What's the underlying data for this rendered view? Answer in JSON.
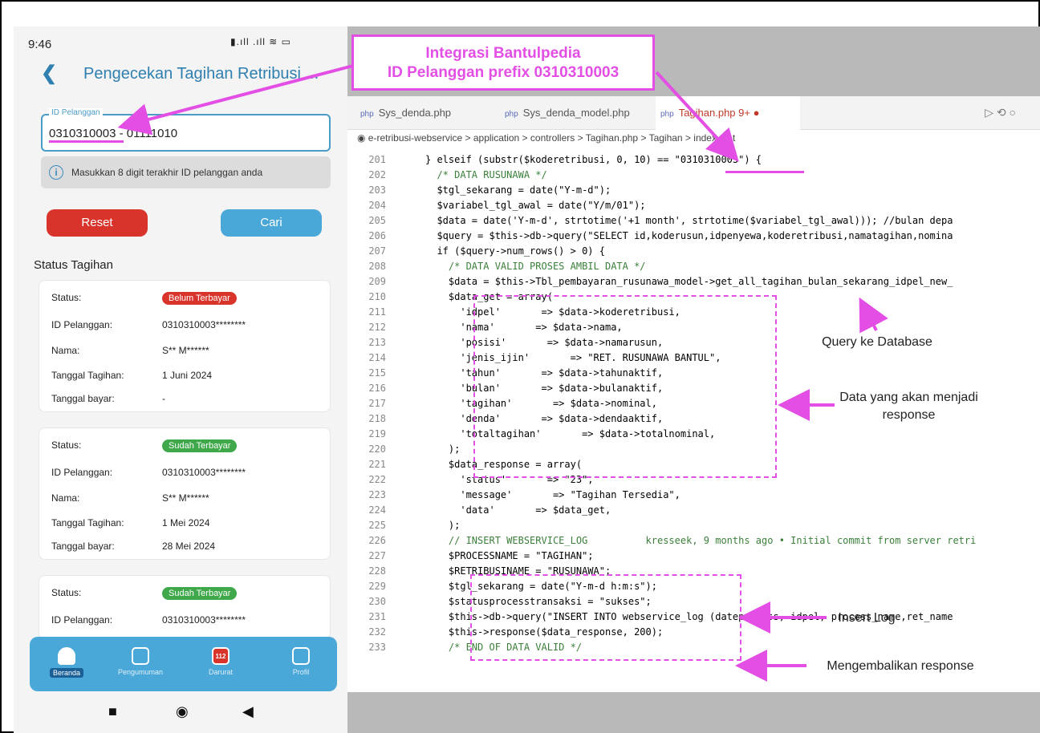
{
  "phone": {
    "status_time": "9:46",
    "status_icons": "▮.ıll .ıll ≋ ▭",
    "title": "Pengecekan Tagihan Retribusi ...",
    "id_label": "ID Pelanggan",
    "id_value": "0310310003 - 01111010",
    "hint": "Masukkan 8 digit terakhir ID pelanggan anda",
    "reset": "Reset",
    "cari": "Cari",
    "status_heading": "Status Tagihan",
    "cards": [
      {
        "status_label": "Status:",
        "status": "Belum Terbayar",
        "id_label": "ID Pelanggan:",
        "id": "0310310003********",
        "nama_label": "Nama:",
        "nama": "S** M******",
        "tgl_label": "Tanggal Tagihan:",
        "tgl": "1 Juni 2024",
        "bayar_label": "Tanggal bayar:",
        "bayar": "-"
      },
      {
        "status_label": "Status:",
        "status": "Sudah Terbayar",
        "id_label": "ID Pelanggan:",
        "id": "0310310003********",
        "nama_label": "Nama:",
        "nama": "S** M******",
        "tgl_label": "Tanggal Tagihan:",
        "tgl": "1 Mei 2024",
        "bayar_label": "Tanggal bayar:",
        "bayar": "28 Mei 2024"
      },
      {
        "status_label": "Status:",
        "status": "Sudah Terbayar",
        "id_label": "ID Pelanggan:",
        "id": "0310310003********"
      }
    ],
    "nav": [
      "Beranda",
      "Pengumuman",
      "Darurat",
      "Profil"
    ],
    "nav_badge": "112",
    "sys_nav": [
      "■",
      "◉",
      "◀"
    ]
  },
  "callout": [
    "Integrasi Bantulpedia",
    "ID Pelanggan prefix 0310310003"
  ],
  "editor": {
    "tabs": [
      "Sys_denda.php",
      "Sys_denda_model.php",
      "Tagihan.php 9+ ●"
    ],
    "tab_icon": "php",
    "toolbar": "▷ ⟲ ○",
    "breadcrumb": "◉ e-retribusi-webservice > application > controllers > Tagihan.php > Tagihan > index_get",
    "lines": [
      {
        "n": "201",
        "t": "} elseif (substr($koderetribusi, 0, 10) == \"0310310003\") {"
      },
      {
        "n": "202",
        "t": "  /* DATA RUSUNAWA */"
      },
      {
        "n": "203",
        "t": "  $tgl_sekarang = date(\"Y-m-d\");"
      },
      {
        "n": "204",
        "t": "  $variabel_tgl_awal = date(\"Y/m/01\");"
      },
      {
        "n": "205",
        "t": "  $data = date('Y-m-d', strtotime('+1 month', strtotime($variabel_tgl_awal))); //bulan depa"
      },
      {
        "n": "206",
        "t": "  $query = $this->db->query(\"SELECT id,koderusun,idpenyewa,koderetribusi,namatagihan,nomina"
      },
      {
        "n": "207",
        "t": "  if ($query->num_rows() > 0) {"
      },
      {
        "n": "208",
        "t": "    /* DATA VALID PROSES AMBIL DATA */"
      },
      {
        "n": "209",
        "t": "    $data = $this->Tbl_pembayaran_rusunawa_model->get_all_tagihan_bulan_sekarang_idpel_new_"
      },
      {
        "n": "210",
        "t": "    $data_get = array("
      },
      {
        "n": "211",
        "t": "      'idpel'       => $data->koderetribusi,"
      },
      {
        "n": "212",
        "t": "      'nama'       => $data->nama,"
      },
      {
        "n": "213",
        "t": "      'posisi'       => $data->namarusun,"
      },
      {
        "n": "214",
        "t": "      'jenis_ijin'       => \"RET. RUSUNAWA BANTUL\","
      },
      {
        "n": "215",
        "t": "      'tahun'       => $data->tahunaktif,"
      },
      {
        "n": "216",
        "t": "      'bulan'       => $data->bulanaktif,"
      },
      {
        "n": "217",
        "t": "      'tagihan'       => $data->nominal,"
      },
      {
        "n": "218",
        "t": "      'denda'       => $data->dendaaktif,"
      },
      {
        "n": "219",
        "t": "      'totaltagihan'       => $data->totalnominal,"
      },
      {
        "n": "220",
        "t": "    );"
      },
      {
        "n": "221",
        "t": "    $data_response = array("
      },
      {
        "n": "222",
        "t": "      'status'       => \"23\","
      },
      {
        "n": "223",
        "t": "      'message'       => \"Tagihan Tersedia\","
      },
      {
        "n": "224",
        "t": "      'data'       => $data_get,"
      },
      {
        "n": "225",
        "t": "    );"
      },
      {
        "n": "226",
        "t": "    // INSERT WEBSERVICE_LOG          kresseek, 9 months ago • Initial commit from server retri"
      },
      {
        "n": "227",
        "t": "    $PROCESSNAME = \"TAGIHAN\";"
      },
      {
        "n": "228",
        "t": "    $RETRIBUSINAME = \"RUSUNAWA\";"
      },
      {
        "n": "229",
        "t": "    $tgl_sekarang = date(\"Y-m-d h:m:s\");"
      },
      {
        "n": "230",
        "t": "    $statusprocesstransaksi = \"sukses\";"
      },
      {
        "n": "231",
        "t": "    $this->db->query(\"INSERT INTO webservice_log (dateprocess, idpel, process_name,ret_name"
      },
      {
        "n": "232",
        "t": "    $this->response($data_response, 200);"
      },
      {
        "n": "233",
        "t": "    /* END OF DATA VALID */"
      }
    ]
  },
  "annotations": {
    "query": "Query ke Database",
    "response": "Data yang akan menjadi response",
    "log": "Insert Log",
    "return": "Mengembalikan response"
  },
  "accent": "#e34fe5"
}
